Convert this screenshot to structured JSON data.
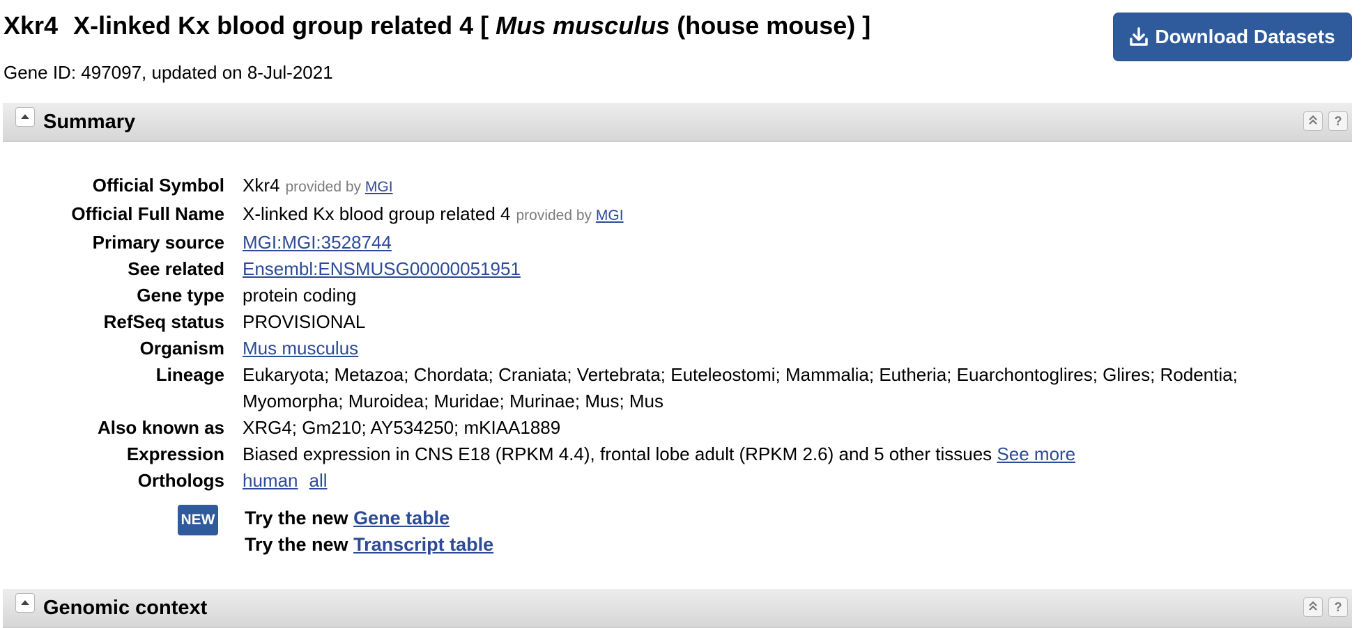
{
  "header": {
    "symbol": "Xkr4",
    "name_prefix": "X-linked Kx blood group related 4 [",
    "organism_italic": "Mus musculus",
    "organism_suffix": "(house mouse) ]",
    "gene_id_line": "Gene ID: 497097, updated on 8-Jul-2021",
    "download_label": "Download Datasets"
  },
  "sections": {
    "summary_title": "Summary",
    "genomic_title": "Genomic context"
  },
  "summary": {
    "official_symbol": {
      "label": "Official Symbol",
      "value": "Xkr4",
      "provided_by": "provided by",
      "provider": "MGI"
    },
    "official_full_name": {
      "label": "Official Full Name",
      "value": "X-linked Kx blood group related 4",
      "provided_by": "provided by",
      "provider": "MGI"
    },
    "primary_source": {
      "label": "Primary source",
      "link": "MGI:MGI:3528744"
    },
    "see_related": {
      "label": "See related",
      "link": "Ensembl:ENSMUSG00000051951"
    },
    "gene_type": {
      "label": "Gene type",
      "value": "protein coding"
    },
    "refseq_status": {
      "label": "RefSeq status",
      "value": "PROVISIONAL"
    },
    "organism": {
      "label": "Organism",
      "link": "Mus musculus"
    },
    "lineage": {
      "label": "Lineage",
      "line1": "Eukaryota; Metazoa; Chordata; Craniata; Vertebrata; Euteleostomi; Mammalia; Eutheria; Euarchontoglires; Glires; Rodentia;",
      "line2": "Myomorpha; Muroidea; Muridae; Murinae; Mus; Mus"
    },
    "also_known_as": {
      "label": "Also known as",
      "value": "XRG4; Gm210; AY534250; mKIAA1889"
    },
    "expression": {
      "label": "Expression",
      "value": "Biased expression in CNS E18 (RPKM 4.4), frontal lobe adult (RPKM 2.6) and 5 other tissues",
      "link": "See more"
    },
    "orthologs": {
      "label": "Orthologs",
      "links": [
        "human",
        "all"
      ]
    }
  },
  "new_block": {
    "badge": "NEW",
    "try_prefix": "Try the new",
    "gene_table_link": "Gene table",
    "transcript_table_link": "Transcript table"
  },
  "icons": [
    "download-icon",
    "collapse-arrow-icon",
    "scroll-to-top-icon",
    "help-icon"
  ]
}
